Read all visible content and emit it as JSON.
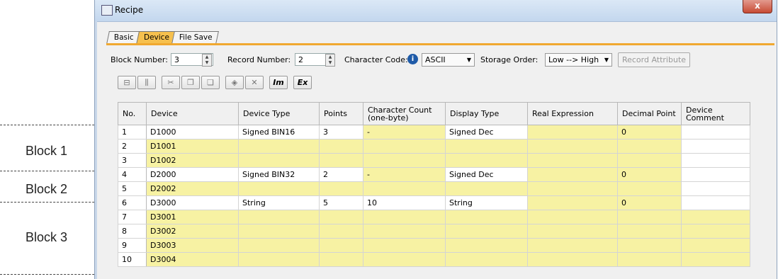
{
  "annotations": [
    "Block 1",
    "Block 2",
    "Block 3"
  ],
  "window": {
    "title": "Recipe",
    "close_label": "x"
  },
  "tabs": [
    "Basic",
    "Device",
    "File Save"
  ],
  "form": {
    "block_number_label": "Block Number:",
    "block_number_value": "3",
    "record_number_label": "Record Number:",
    "record_number_value": "2",
    "character_code_label": "Character Code:",
    "character_code_value": "ASCII",
    "storage_order_label": "Storage Order:",
    "storage_order_value": "Low --> High",
    "record_attribute_label": "Record Attribute"
  },
  "toolbar": [
    {
      "name": "insert-row-icon",
      "glyph": "⊟"
    },
    {
      "name": "insert-col-icon",
      "glyph": "⫼"
    },
    {
      "name": "cut-icon",
      "glyph": "✂"
    },
    {
      "name": "copy-icon",
      "glyph": "❐"
    },
    {
      "name": "paste-icon",
      "glyph": "❏"
    },
    {
      "name": "clear-icon",
      "glyph": "◈"
    },
    {
      "name": "delete-icon",
      "glyph": "✕"
    },
    {
      "name": "import-icon",
      "glyph": "Im"
    },
    {
      "name": "export-icon",
      "glyph": "Ex"
    }
  ],
  "table": {
    "headers": [
      "No.",
      "Device",
      "Device Type",
      "Points",
      "Character Count\n(one-byte)",
      "Display Type",
      "Real Expression",
      "Decimal Point",
      "Device Comment"
    ],
    "rows": [
      {
        "cells": [
          "1",
          "D1000",
          "Signed BIN16",
          "3",
          "-",
          "Signed Dec",
          "",
          "0",
          ""
        ],
        "shade": "wwwwywyyw"
      },
      {
        "cells": [
          "2",
          "D1001",
          "",
          "",
          "",
          "",
          "",
          "",
          ""
        ],
        "shade": "wyyyyyyyw"
      },
      {
        "cells": [
          "3",
          "D1002",
          "",
          "",
          "",
          "",
          "",
          "",
          ""
        ],
        "shade": "wyyyyyyyw"
      },
      {
        "cells": [
          "4",
          "D2000",
          "Signed BIN32",
          "2",
          "-",
          "Signed Dec",
          "",
          "0",
          ""
        ],
        "shade": "wwwwywyyw"
      },
      {
        "cells": [
          "5",
          "D2002",
          "",
          "",
          "",
          "",
          "",
          "",
          ""
        ],
        "shade": "wyyyyyyyw"
      },
      {
        "cells": [
          "6",
          "D3000",
          "String",
          "5",
          "10",
          "String",
          "",
          "0",
          ""
        ],
        "shade": "wwwwwwyyw"
      },
      {
        "cells": [
          "7",
          "D3001",
          "",
          "",
          "",
          "",
          "",
          "",
          ""
        ],
        "shade": "wyyyyyyyy"
      },
      {
        "cells": [
          "8",
          "D3002",
          "",
          "",
          "",
          "",
          "",
          "",
          ""
        ],
        "shade": "wyyyyyyyy"
      },
      {
        "cells": [
          "9",
          "D3003",
          "",
          "",
          "",
          "",
          "",
          "",
          ""
        ],
        "shade": "wyyyyyyyy"
      },
      {
        "cells": [
          "10",
          "D3004",
          "",
          "",
          "",
          "",
          "",
          "",
          ""
        ],
        "shade": "wyyyyyyyy"
      }
    ]
  }
}
